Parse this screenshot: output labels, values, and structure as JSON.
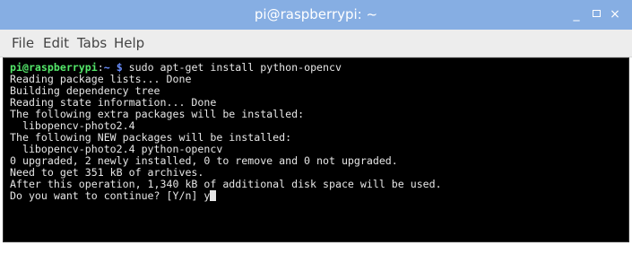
{
  "window": {
    "title": "pi@raspberrypi: ~",
    "controls": {
      "minimize": "_",
      "close": "×"
    }
  },
  "menubar": {
    "items": [
      {
        "label": "File"
      },
      {
        "label": "Edit"
      },
      {
        "label": "Tabs"
      },
      {
        "label": "Help"
      }
    ]
  },
  "terminal": {
    "prompt": {
      "user_host": "pi@raspberrypi",
      "separator": ":",
      "path": "~",
      "symbol": "$",
      "command": " sudo apt-get install python-opencv"
    },
    "output_lines": [
      "Reading package lists... Done",
      "Building dependency tree",
      "Reading state information... Done",
      "The following extra packages will be installed:",
      "  libopencv-photo2.4",
      "The following NEW packages will be installed:",
      "  libopencv-photo2.4 python-opencv",
      "0 upgraded, 2 newly installed, 0 to remove and 0 not upgraded.",
      "Need to get 351 kB of archives.",
      "After this operation, 1,340 kB of additional disk space will be used."
    ],
    "final_prompt": "Do you want to continue? [Y/n] ",
    "final_input": "y"
  },
  "colors": {
    "titlebar": "#86aee3",
    "menubar": "#ededed",
    "terminal_bg": "#000000",
    "terminal_fg": "#e6e6e6",
    "prompt_user": "#54e86a",
    "prompt_path": "#6b8fff"
  }
}
